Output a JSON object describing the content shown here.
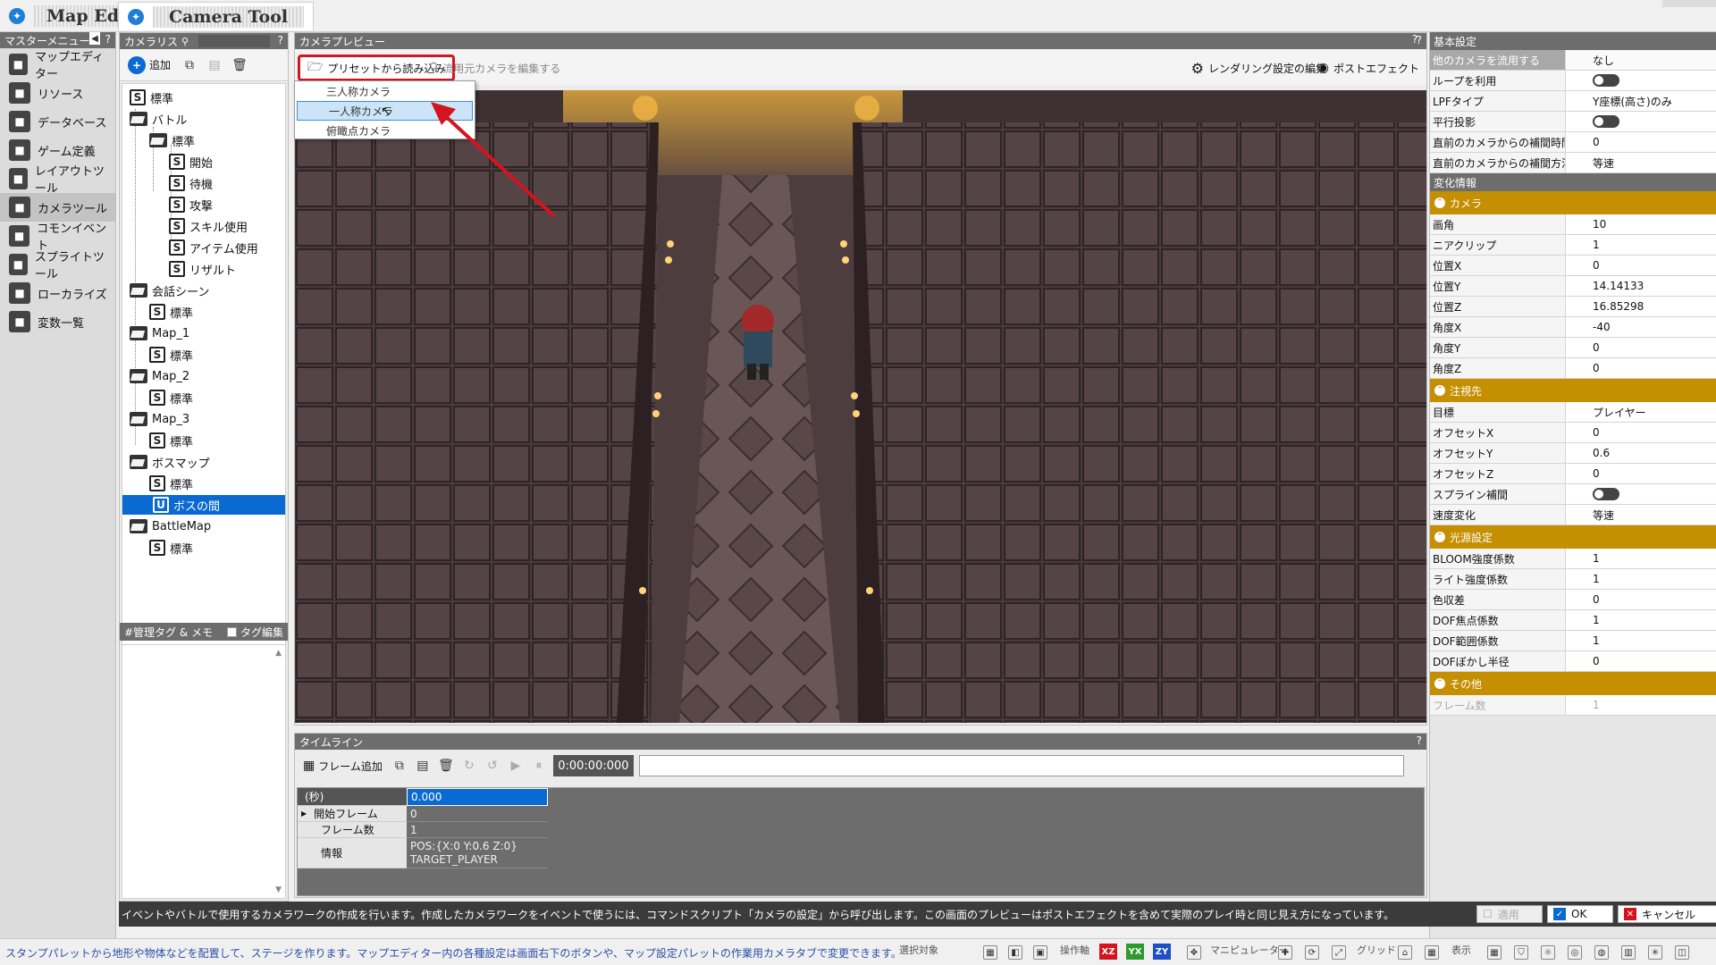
{
  "tabs": [
    {
      "label": "Map Editor"
    },
    {
      "label": "Camera Tool"
    }
  ],
  "master_menu": {
    "title": "マスターメニュー",
    "help": "?",
    "items": [
      {
        "label": "マップエディター",
        "icon": "map-editor-icon"
      },
      {
        "label": "リソース",
        "icon": "resource-icon"
      },
      {
        "label": "データベース",
        "icon": "database-icon"
      },
      {
        "label": "ゲーム定義",
        "icon": "game-definition-icon"
      },
      {
        "label": "レイアウトツール",
        "icon": "layout-tool-icon"
      },
      {
        "label": "カメラツール",
        "icon": "camera-tool-icon"
      },
      {
        "label": "コモンイベント",
        "icon": "common-event-icon"
      },
      {
        "label": "スプライトツール",
        "icon": "sprite-tool-icon"
      },
      {
        "label": "ローカライズ",
        "icon": "localize-icon"
      },
      {
        "label": "変数一覧",
        "icon": "variables-icon"
      }
    ]
  },
  "camera_list": {
    "title": "カメラリス",
    "help": "?",
    "add_label": "追加",
    "tree": [
      {
        "label": "標準",
        "type": "s",
        "depth": 0
      },
      {
        "label": "バトル",
        "type": "folder",
        "depth": 0
      },
      {
        "label": "標準",
        "type": "folder",
        "depth": 1
      },
      {
        "label": "開始",
        "type": "s",
        "depth": 2
      },
      {
        "label": "待機",
        "type": "s",
        "depth": 2
      },
      {
        "label": "攻撃",
        "type": "s",
        "depth": 2
      },
      {
        "label": "スキル使用",
        "type": "s",
        "depth": 2
      },
      {
        "label": "アイテム使用",
        "type": "s",
        "depth": 2
      },
      {
        "label": "リザルト",
        "type": "s",
        "depth": 2
      },
      {
        "label": "会話シーン",
        "type": "folder",
        "depth": 0
      },
      {
        "label": "標準",
        "type": "s",
        "depth": 1
      },
      {
        "label": "Map_1",
        "type": "folder",
        "depth": 0
      },
      {
        "label": "標準",
        "type": "s",
        "depth": 1
      },
      {
        "label": "Map_2",
        "type": "folder",
        "depth": 0
      },
      {
        "label": "標準",
        "type": "s",
        "depth": 1
      },
      {
        "label": "Map_3",
        "type": "folder",
        "depth": 0
      },
      {
        "label": "標準",
        "type": "s",
        "depth": 1
      },
      {
        "label": "ボスマップ",
        "type": "folder",
        "depth": 0
      },
      {
        "label": "標準",
        "type": "s",
        "depth": 1
      },
      {
        "label": "ボスの間",
        "type": "u",
        "depth": 1,
        "selected": true
      },
      {
        "label": "BattleMap",
        "type": "folder",
        "depth": 0
      },
      {
        "label": "標準",
        "type": "s",
        "depth": 1
      }
    ],
    "memo_title": "#管理タグ & メモ",
    "tag_edit_label": "タグ編集"
  },
  "preview": {
    "title": "カメラプレビュー",
    "help": "?",
    "preset_button": "プリセットから読み込み",
    "edit_source_button": "流用元カメラを編集する",
    "render_settings_button": "レンダリング設定の編集",
    "post_effect_button": "ポストエフェクト",
    "dropdown": [
      "三人称カメラ",
      "一人称カメラ",
      "俯瞰点カメラ"
    ],
    "dropdown_highlight": 1
  },
  "timeline": {
    "title": "タイムライン",
    "help": "?",
    "add_frame_label": "フレーム追加",
    "timecode": "0:00:00:000",
    "rows": [
      {
        "label": "(秒)",
        "value": "0.000"
      },
      {
        "label": "開始フレーム",
        "value": "0"
      },
      {
        "label": "フレーム数",
        "value": "1"
      },
      {
        "label": "情報",
        "value": "POS:{X:0 Y:0.6 Z:0}",
        "value2": "TARGET_PLAYER"
      }
    ]
  },
  "settings": {
    "basic_header": "基本設定",
    "help": "?",
    "basic": [
      {
        "k": "他のカメラを流用する",
        "v": "なし",
        "dark": true
      },
      {
        "k": "ループを利用",
        "v": "",
        "toggle": true
      },
      {
        "k": "LPFタイプ",
        "v": "Y座標(高さ)のみ"
      },
      {
        "k": "平行投影",
        "v": "",
        "toggle": true
      },
      {
        "k": "直前のカメラからの補間時間(秒)",
        "v": "0"
      },
      {
        "k": "直前のカメラからの補間方法",
        "v": "等速"
      }
    ],
    "change_header": "変化情報",
    "sections": [
      {
        "title": "カメラ",
        "rows": [
          {
            "k": "画角",
            "v": "10"
          },
          {
            "k": "ニアクリップ",
            "v": "1"
          },
          {
            "k": "位置X",
            "v": "0"
          },
          {
            "k": "位置Y",
            "v": "14.14133"
          },
          {
            "k": "位置Z",
            "v": "16.85298"
          },
          {
            "k": "角度X",
            "v": "-40"
          },
          {
            "k": "角度Y",
            "v": "0"
          },
          {
            "k": "角度Z",
            "v": "0"
          }
        ]
      },
      {
        "title": "注視先",
        "rows": [
          {
            "k": "目標",
            "v": "プレイヤー"
          },
          {
            "k": "オフセットX",
            "v": "0"
          },
          {
            "k": "オフセットY",
            "v": "0.6"
          },
          {
            "k": "オフセットZ",
            "v": "0"
          },
          {
            "k": "スプライン補間",
            "v": "",
            "toggle": true
          },
          {
            "k": "速度変化",
            "v": "等速"
          }
        ]
      },
      {
        "title": "光源設定",
        "rows": [
          {
            "k": "BLOOM強度係数",
            "v": "1"
          },
          {
            "k": "ライト強度係数",
            "v": "1"
          },
          {
            "k": "色収差",
            "v": "0"
          },
          {
            "k": "DOF焦点係数",
            "v": "1"
          },
          {
            "k": "DOF範囲係数",
            "v": "1"
          },
          {
            "k": "DOFぼかし半径",
            "v": "0"
          }
        ]
      },
      {
        "title": "その他",
        "rows": [
          {
            "k": "フレーム数",
            "v": "1",
            "disabled": true
          }
        ]
      }
    ]
  },
  "description": "イベントやバトルで使用するカメラワークの作成を行います。作成したカメラワークをイベントで使うには、コマンドスクリプト「カメラの設定」から呼び出します。この画面のプレビューはポストエフェクトを含めて実際のプレイ時と同じ見え方になっています。",
  "dialog": {
    "apply": "適用",
    "ok": "OK",
    "cancel": "キャンセル"
  },
  "statusbar": {
    "text": "スタンプパレットから地形や物体などを配置して、ステージを作ります。マップエディター内の各種設定は画面右下のボタンや、マップ設定パレットの作業用カメラタブで変更できます。",
    "select_label": "選択対象",
    "operation_axis_label": "操作軸",
    "axes": [
      "XZ",
      "YX",
      "ZY"
    ],
    "manipulator_label": "マニピュレーター",
    "grid_label": "グリッド",
    "display_label": "表示"
  },
  "colors": {
    "accent": "#0a6ad1",
    "section": "#c48f00",
    "highlight_red": "#d4141e"
  }
}
